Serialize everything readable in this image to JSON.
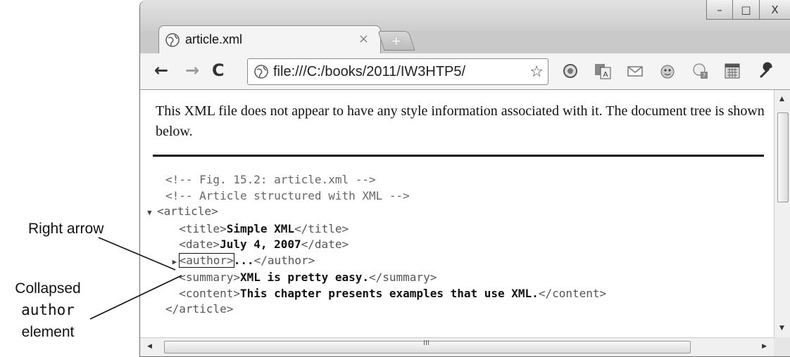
{
  "callouts": {
    "right_arrow": "Right arrow",
    "collapsed_line1": "Collapsed",
    "collapsed_mono": "author",
    "collapsed_line3": "element"
  },
  "window": {
    "controls": {
      "minimize": "–",
      "maximize": "□",
      "close": "X"
    },
    "tab": {
      "title": "article.xml",
      "close": "×",
      "icon": "globe-icon"
    },
    "new_tab": "+"
  },
  "toolbar": {
    "back": "←",
    "forward": "→",
    "reload": "C",
    "url": "file:///C:/books/2011/IW3HTP5/",
    "star": "☆",
    "extensions": [
      "extension-icon",
      "translate-icon",
      "mail-icon",
      "emoji-icon",
      "phone-icon",
      "calendar-icon",
      "wrench-icon"
    ]
  },
  "content": {
    "notice": "This XML file does not appear to have any style information associated with it. The document tree is shown below.",
    "tree": {
      "comment1": "<!-- Fig. 15.2: article.xml -->",
      "comment2": "<!-- Article structured with XML -->",
      "expanded_arrow": "▼",
      "collapsed_arrow": "▶",
      "article_open": "<article>",
      "title_open": "<title>",
      "title_text": "Simple XML",
      "title_close": "</title>",
      "date_open": "<date>",
      "date_text": "July 4, 2007",
      "date_close": "</date>",
      "author_open": "<author>",
      "author_text": "...",
      "author_close": "</author>",
      "summary_open": "<summary>",
      "summary_text": "XML is pretty easy.",
      "summary_close": "</summary>",
      "content_open": "<content>",
      "content_text": "This chapter presents examples that use XML.",
      "content_close": "</content>",
      "article_close": "</article>"
    }
  },
  "scrollbars": {
    "h_grip": "III",
    "left": "◀",
    "right": "▶",
    "up": "▲",
    "down": "▼"
  }
}
